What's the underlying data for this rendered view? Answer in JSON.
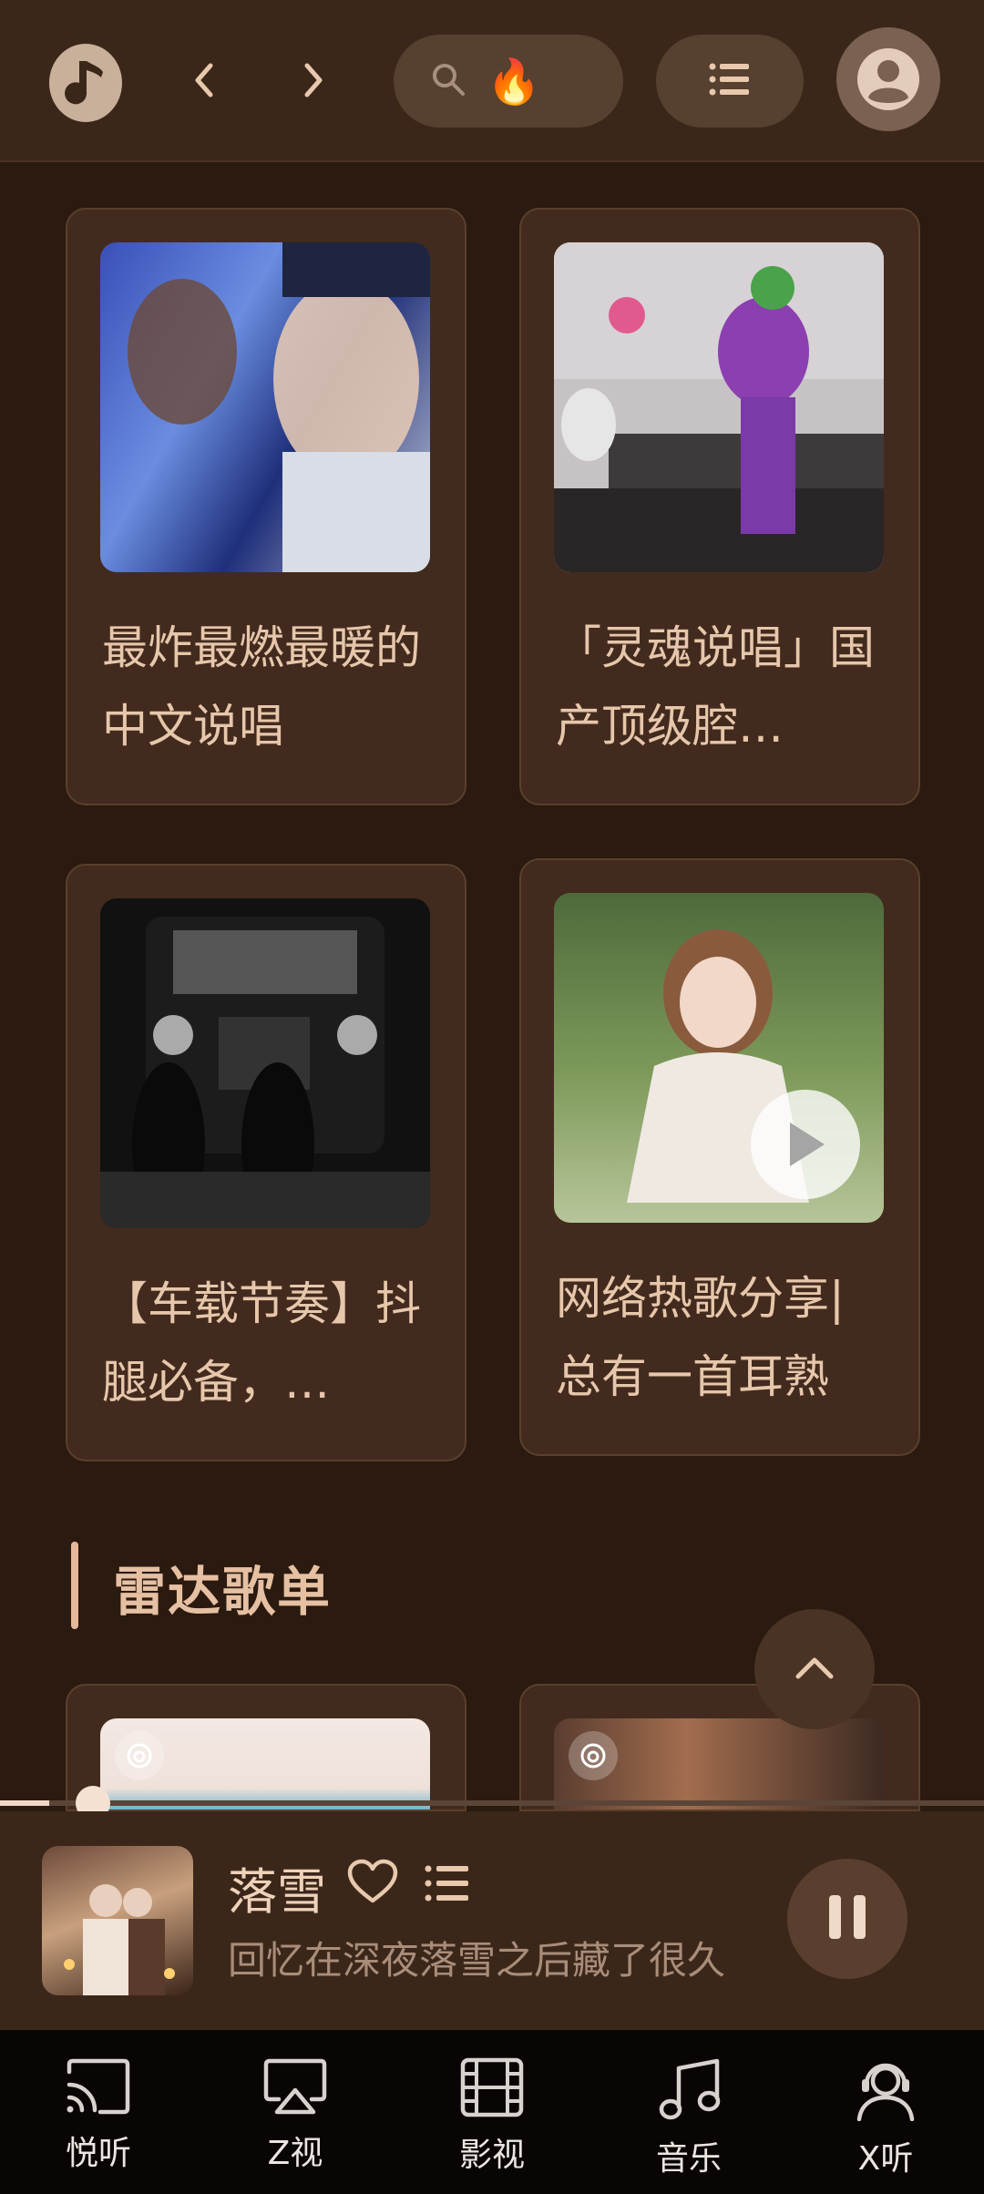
{
  "header": {
    "logo_icon": "music-note-logo-icon",
    "search": {
      "hint_emoji": "🔥"
    }
  },
  "playlists": [
    {
      "title": "最炸最燃最暖的中文说唱"
    },
    {
      "title": "「灵魂说唱」国产顶级腔…"
    },
    {
      "title": "【车载节奏】抖腿必备，…"
    },
    {
      "title": "网络热歌分享|总有一首耳熟"
    }
  ],
  "section": {
    "title": "雷达歌单"
  },
  "player": {
    "song": "落雪",
    "lyric": "回忆在深夜落雪之后藏了很久",
    "progress": 0.05
  },
  "bottom_nav": [
    {
      "label": "悦听",
      "icon": "cast-icon"
    },
    {
      "label": "Z视",
      "icon": "airplay-icon"
    },
    {
      "label": "影视",
      "icon": "film-icon"
    },
    {
      "label": "音乐",
      "icon": "music-notes-icon"
    },
    {
      "label": "X听",
      "icon": "headset-user-icon"
    }
  ],
  "colors": {
    "accent": "#e6b79a",
    "background": "#2a1a10",
    "card": "#422b1e",
    "nav": "#090504"
  }
}
